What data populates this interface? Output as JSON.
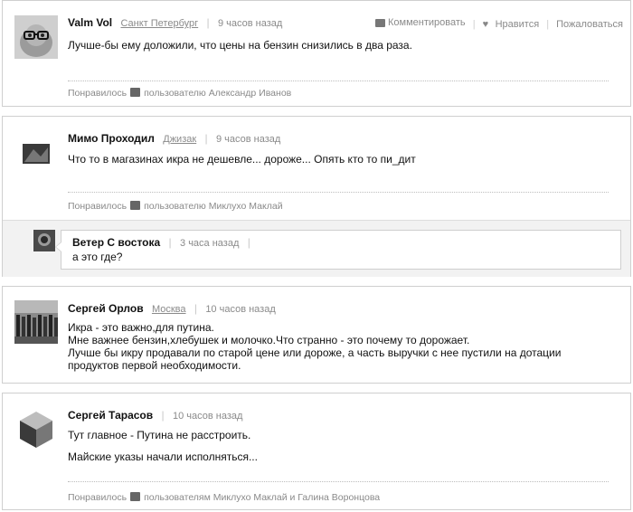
{
  "actions": {
    "comment": "Комментировать",
    "like": "Нравится",
    "complain": "Пожаловаться"
  },
  "liked_prefix": "Понравилось",
  "comments": [
    {
      "author": "Valm Vol",
      "city": "Санкт Петербург",
      "time": "9 часов назад",
      "text": "Лучше-бы ему доложили, что цены на бензин снизились в два раза.",
      "liked_by": "пользователю Александр Иванов"
    },
    {
      "author": "Мимо Проходил",
      "city": "Джизак",
      "time": "9 часов назад",
      "text": "Что то в магазинах икра не дешевле... дороже... Опять кто то пи_дит",
      "liked_by": "пользователю Миклухо Маклай",
      "reply": {
        "author": "Ветер С востока",
        "time": "3 часа назад",
        "text": "а это где?"
      }
    },
    {
      "author": "Сергей Орлов",
      "city": "Москва",
      "time": "10 часов назад",
      "lines": [
        "Икра - это важно,для путина.",
        "Мне важнее бензин,хлебушек и молочко.Что странно - это почему то дорожает.",
        "Лучше бы икру продавали по старой цене или дороже, а часть выручки с нее пустили на дотации",
        "продуктов первой необходимости."
      ]
    },
    {
      "author": "Сергей Тарасов",
      "time": "10 часов назад",
      "lines": [
        "Тут главное - Путина не расстроить.",
        "Майские указы начали исполняться..."
      ],
      "liked_by": "пользователям Миклухо Маклай и Галина Воронцова"
    }
  ]
}
